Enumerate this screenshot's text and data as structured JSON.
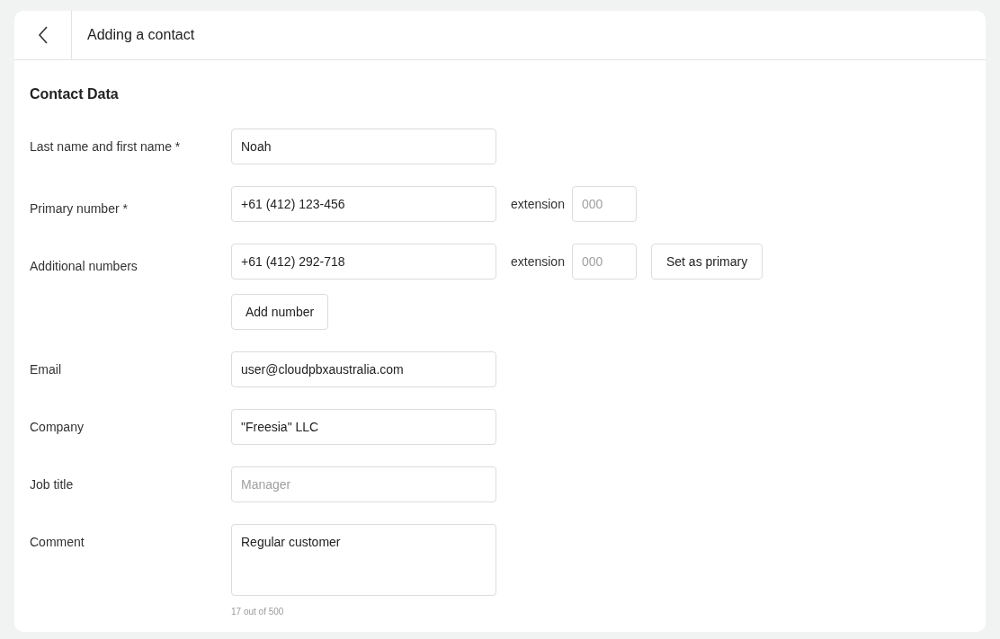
{
  "header": {
    "title": "Adding a contact"
  },
  "section": {
    "title": "Contact Data"
  },
  "rows": [
    {
      "kind": "text",
      "label": "Last name and first name *",
      "value": "Noah"
    },
    {
      "kind": "phone",
      "label": "Primary number *",
      "value": "+61 (412) 123-456",
      "extension_label": "extension",
      "extension_placeholder": "000"
    },
    {
      "kind": "phone",
      "label": "Additional numbers",
      "value": "+61 (412) 292-718",
      "extension_label": "extension",
      "extension_placeholder": "000",
      "action": "Set as primary"
    },
    {
      "kind": "button",
      "action": "Add number"
    },
    {
      "kind": "text",
      "label": "Email",
      "value": "user@cloudpbxaustralia.com"
    },
    {
      "kind": "text",
      "label": "Company",
      "value": "\"Freesia\" LLC"
    },
    {
      "kind": "text",
      "label": "Job title",
      "placeholder": "Manager"
    },
    {
      "kind": "textarea",
      "label": "Comment",
      "value": "Regular customer",
      "counter": "17 out of 500"
    }
  ]
}
